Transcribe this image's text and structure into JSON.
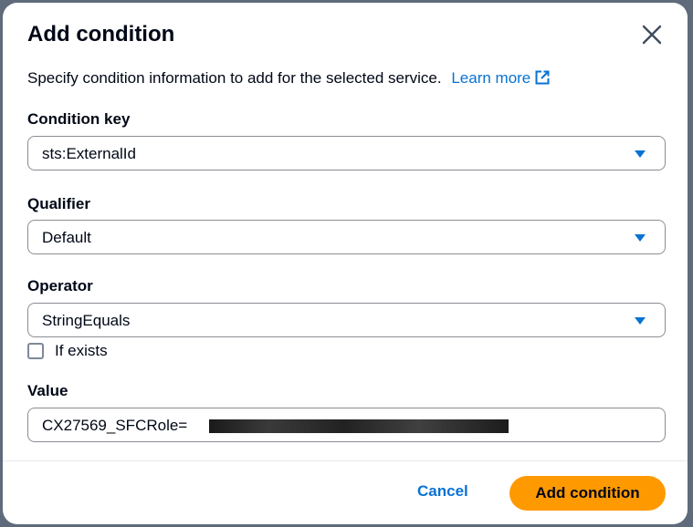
{
  "modal": {
    "title": "Add condition",
    "description": "Specify condition information to add for the selected service.",
    "learn_more": "Learn more"
  },
  "fields": {
    "condition_key": {
      "label": "Condition key",
      "value": "sts:ExternalId"
    },
    "qualifier": {
      "label": "Qualifier",
      "value": "Default"
    },
    "operator": {
      "label": "Operator",
      "value": "StringEquals"
    },
    "if_exists": {
      "label": "If exists",
      "checked": false
    },
    "value": {
      "label": "Value",
      "value": "CX27569_SFCRole="
    }
  },
  "footer": {
    "cancel_label": "Cancel",
    "submit_label": "Add condition"
  },
  "icons": {
    "close": "close-icon",
    "external_link": "external-link-icon",
    "dropdown": "caret-down-icon"
  },
  "colors": {
    "link": "#0972d3",
    "primary_button": "#ff9900",
    "text": "#000716"
  }
}
